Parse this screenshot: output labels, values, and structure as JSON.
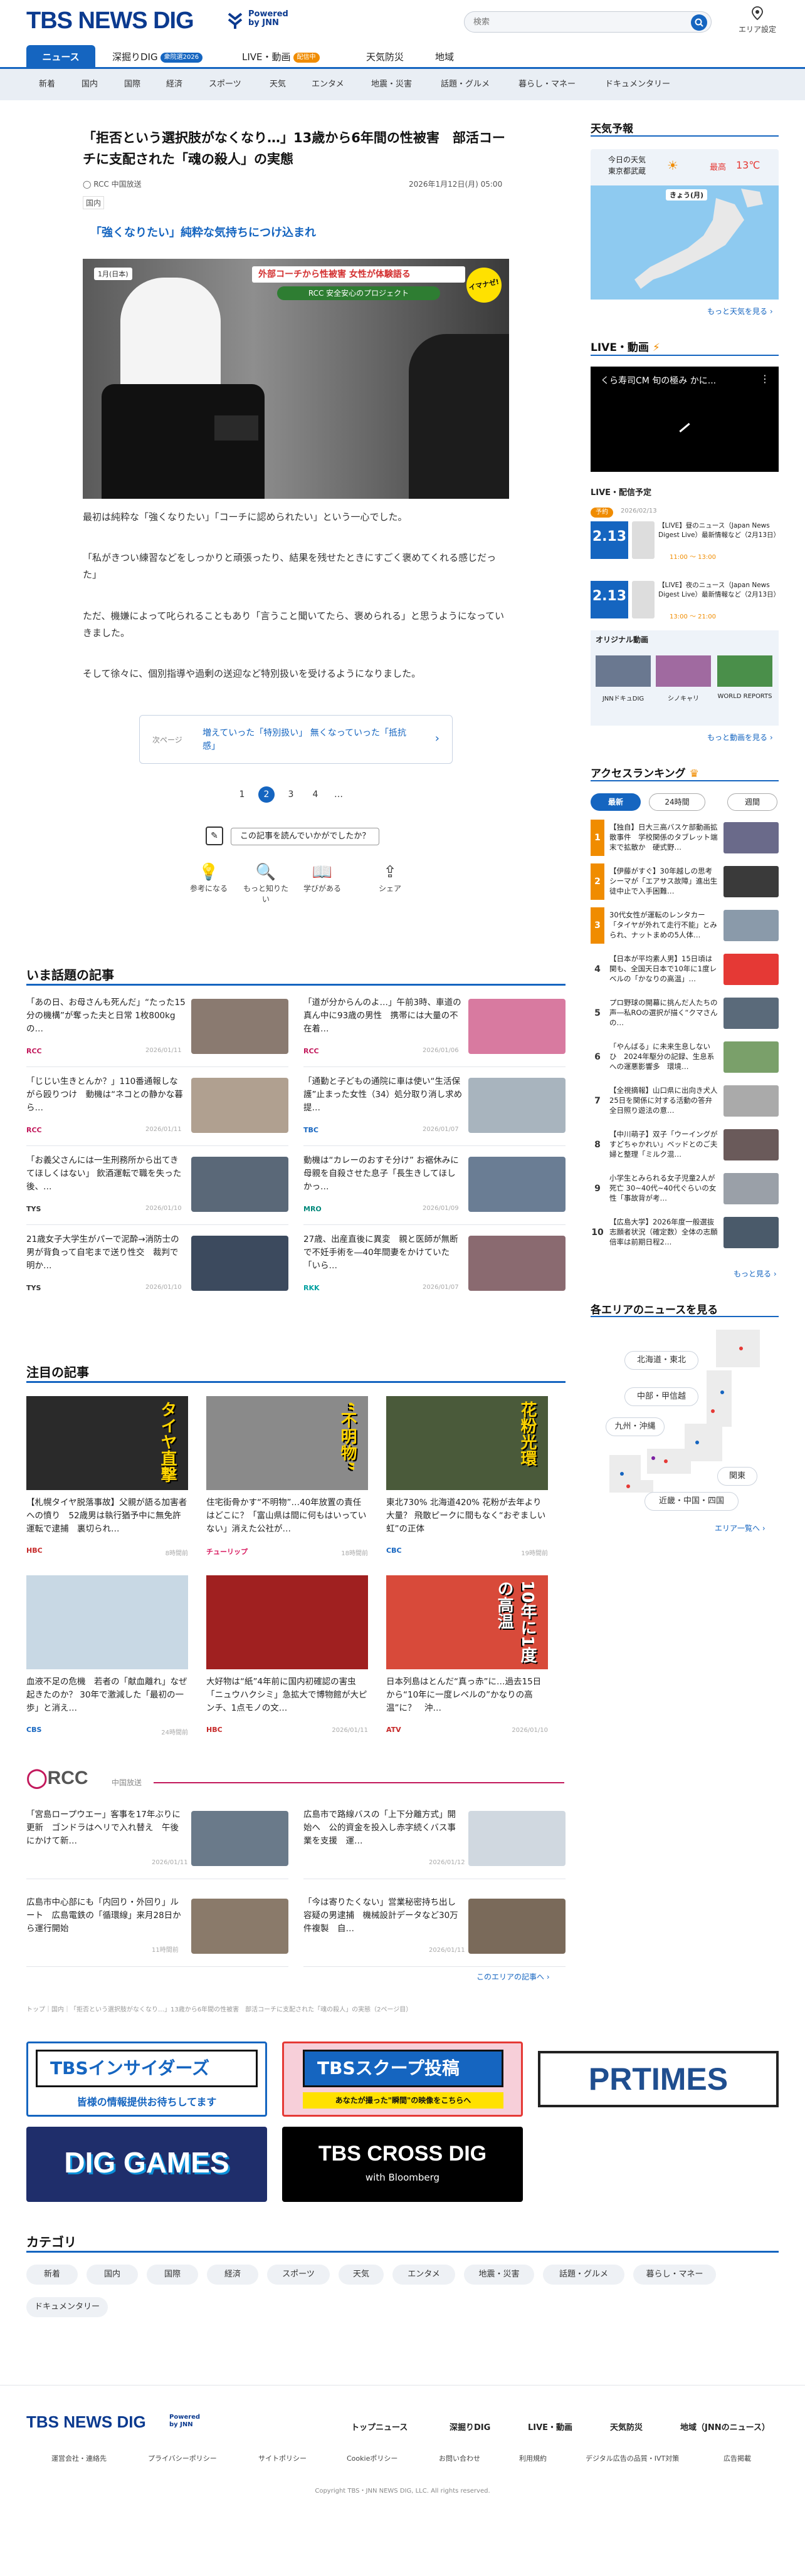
{
  "header": {
    "logo": "TBS NEWS DIG",
    "powered": "Powered by JNN",
    "search_placeholder": "検索",
    "area_label": "エリア設定"
  },
  "nav_main": [
    {
      "label": "ニュース"
    },
    {
      "label": "深掘りDIG",
      "badge": "衆院選2026"
    },
    {
      "label": "LIVE・動画",
      "badge": "配信中"
    },
    {
      "label": "天気防災"
    },
    {
      "label": "地域"
    }
  ],
  "nav_sub": [
    "新着",
    "国内",
    "国際",
    "経済",
    "スポーツ",
    "天気",
    "エンタメ",
    "地震・災害",
    "話題・グルメ",
    "暮らし・マネー",
    "ドキュメンタリー"
  ],
  "article": {
    "title": "「拒否という選択肢がなくなり…」13歳から6年間の性被害　部活コーチに支配された「魂の殺人」の実態",
    "source": "RCC 中国放送",
    "date": "2026年1月12日(月) 05:00",
    "category": "国内",
    "lead": "「強くなりたい」純粋な気持ちにつけ込まれ",
    "photo_caption_top": "外部コーチから性被害 女性が体験語る",
    "photo_caption_sub": "RCC 安全安心のプロジェクト",
    "photo_stamp": "1月(日本)",
    "photo_badge": "イマナゼ!",
    "paragraphs": [
      "最初は純粋な「強くなりたい」「コーチに認められたい」という一心でした。",
      "「私がきつい練習などをしっかりと頑張ったり、結果を残せたときにすごく褒めてくれる感じだった」",
      "ただ、機嫌によって叱られることもあり「言うこと聞いてたら、褒められる」と思うようになっていきました。",
      "そして徐々に、個別指導や過剰の送迎など特別扱いを受けるようになりました。"
    ],
    "next_label": "次ページ",
    "next_title": "増えていった「特別扱い」 無くなっていった「抵抗感」",
    "pages": [
      "1",
      "2",
      "3",
      "4",
      "…"
    ],
    "feedback_q": "この記事を読んでいかがでしたか？",
    "reactions": [
      "参考になる",
      "もっと知りたい",
      "学びがある",
      "シェア"
    ]
  },
  "trending": {
    "heading": "いま話題の記事",
    "items": [
      {
        "title": "「あの日、お母さんも死んだ」“たった15分の機構”が奪った夫と日常 1枚800kgの…",
        "src": "RCC",
        "date": "2026/01/11"
      },
      {
        "title": "「道が分からんのよ…」午前3時、車道の真ん中に93歳の男性　携帯には大量の不在着…",
        "src": "RCC",
        "date": "2026/01/06"
      },
      {
        "title": "「じじい生きとんか？」110番通報しながら殴りつけ　動機は“ネコとの静かな暮ら…",
        "src": "RCC",
        "date": "2026/01/11"
      },
      {
        "title": "「通勤と子どもの通院に車は使い“生活保護”止まった女性（34）処分取り消し求め提…",
        "src": "TBC",
        "date": "2026/01/07"
      },
      {
        "title": "「お義父さんには一生刑務所から出てきてほしくはない」 飲酒運転で職を失った後、…",
        "src": "TYS",
        "date": "2026/01/10"
      },
      {
        "title": "動機は“カレーのおすそ分け” お裾休みに母親を自殺させた息子「長生きしてほしかっ…",
        "src": "MRO",
        "date": "2026/01/09"
      },
      {
        "title": "21歳女子大学生がパーで泥酔→消防士の男が背負って自宅まで送り性交　裁判で明か…",
        "src": "TYS",
        "date": "2026/01/10"
      },
      {
        "title": "27歳、出産直後に異変　親と医師が無断で不妊手術を―40年間妻をかけていた「いら…",
        "src": "RKK",
        "date": "2026/01/07"
      }
    ]
  },
  "featured": {
    "heading": "注目の記事",
    "items": [
      {
        "title": "【札幌タイヤ脱落事故】父親が語る加害者への憤り　52歳男は執行猶予中に無免許運転で逮捕　裏切られ…",
        "src": "HBC",
        "date": "8時間前",
        "img_text": "タイヤ直撃"
      },
      {
        "title": "住宅街骨かす“不明物”…40年放置の責任はどこに？「富山県は間に何もはいっていない」消えた公社が…",
        "src": "チューリップ",
        "date": "18時間前",
        "img_text": "“不明物”"
      },
      {
        "title": "東北730% 北海道420% 花粉が去年より大量？ 飛散ピークに間もなく“おぞましい虹”の正体",
        "src": "CBC",
        "date": "19時間前",
        "img_text": "花粉光環"
      },
      {
        "title": "血液不足の危機　若者の「献血離れ」なぜ起きたのか？ 30年で激減した「最初の一歩」と消え…",
        "src": "CBS",
        "date": "24時間前",
        "img_text": ""
      },
      {
        "title": "大好物は“紙”4年前に国内初確認の害虫「ニュウハクシミ」急拡大で博物館が大ピンチ、1点モノの文…",
        "src": "HBC",
        "date": "2026/01/11",
        "img_text": ""
      },
      {
        "title": "日本列島はとんだ“真っ赤”に…過去15日から“10年に一度レベルの”かなりの高温”に？　沖…",
        "src": "ATV",
        "date": "2026/01/10",
        "img_text": "10年に1度の高温"
      }
    ]
  },
  "local": {
    "logo": "RCC",
    "sub": "中国放送",
    "items": [
      {
        "title": "「宮島ロープウエー」客事を17年ぶりに更新　ゴンドラはヘリで入れ替え　午後にかけて新…",
        "date": "2026/01/11"
      },
      {
        "title": "広島市で路線バスの「上下分離方式」開始へ　公的資金を投入し赤字続くバス事業を支援　運…",
        "date": "2026/01/12"
      },
      {
        "title": "広島市中心部にも「内回り・外回り」ルート　広島電鉄の「循環線」来月28日から運行開始",
        "date": "11時間前"
      },
      {
        "title": "「今は寄りたくない」営業秘密持ち出し容疑の男逮捕　機械設計データなど30万件複製　自…",
        "date": "2026/01/11"
      }
    ],
    "more": "このエリアの記事へ"
  },
  "breadcrumb": "トップ｜国内｜「拒否という選択肢がなくなり…」13歳から6年間の性被害　部活コーチに支配された「魂の殺人」の実態（2ページ目）",
  "banners": [
    {
      "title": "TBSインサイダーズ",
      "sub": "皆様の情報提供お待ちしてます"
    },
    {
      "title": "TBSスクープ投稿",
      "sub": "あなたが撮った\"瞬間\"の映像をこちらへ"
    },
    {
      "title": "PRTIMES",
      "sub": ""
    },
    {
      "title": "DIG GAMES",
      "sub": ""
    },
    {
      "title": "TBS CROSS DIG",
      "sub": "with Bloomberg"
    }
  ],
  "categories": {
    "heading": "カテゴリ",
    "items": [
      "新着",
      "国内",
      "国際",
      "経済",
      "スポーツ",
      "天気",
      "エンタメ",
      "地震・災害",
      "話題・グルメ",
      "暮らし・マネー",
      "ドキュメンタリー"
    ]
  },
  "sidebar": {
    "weather": {
      "heading": "天気予報",
      "label": "今日の天気",
      "region": "東京都武蔵",
      "hi_label": "最高",
      "hi": "13℃",
      "map_title": "きょう(月)",
      "more": "もっと天気を見る"
    },
    "live": {
      "heading": "LIVE・動画",
      "video_title": "くら寿司CM 旬の極み かに...",
      "schedule_heading": "LIVE・配信予定",
      "sched": [
        {
          "tag": "予約",
          "tagdate": "2026/02/13",
          "date": "2.13",
          "day": "金",
          "text": "【LIVE】昼のニュース（Japan News Digest Live）最新情報など（2月13日）",
          "time": "11:00 ～ 13:00"
        },
        {
          "tag": "",
          "tagdate": "",
          "date": "2.13",
          "day": "金",
          "text": "【LIVE】夜のニュース（Japan News Digest Live）最新情報など（2月13日）",
          "time": "13:00 ～ 21:00"
        }
      ],
      "original_heading": "オリジナル動画",
      "originals": [
        "JNNドキュDIG",
        "シノキャリ",
        "WORLD REPORTS"
      ],
      "more": "もっと動画を見る"
    },
    "ranking": {
      "heading": "アクセスランキング",
      "tabs": [
        "最新",
        "24時間",
        "週間"
      ],
      "items": [
        "【独自】日大三高バスケ部動画拡散事件　学校関係のタブレット端末で拡散か　硬式野…",
        "【伊藤がすぐ】30年越しの思考シーマが「エアサス故障」進出生徒中止で入手困難…",
        "30代女性が運転のレンタカー「タイヤが外れて走行不能」とみられ、ナットまめの5人体…",
        "【日本が平均素人男】15日頃は関も、全国天日本で10年に1度レベルの「かなりの高温」…",
        "プロ野球の開幕に挑んだ人たちの声―私ROの選択が描く“クマさんの…",
        "「やんばる」に未来生息しない　ひ　2024年駆分の記録、生息系への運悪影響多　環境…",
        "【全視摘報】山口県に出向き犬人25日を関係に対する活動の答弁　全日照り遊法の意…",
        "【中川萌子】双子「ウーイングがすどちゃかれい」ベッドとのご夫婦と整理「ミルク混…",
        "小学生とみられる女子児童2人が死亡 30~40代~40代ぐらいの女性「事故背が考…",
        "【広島大学】2026年度一般選抜志願者状況（確定数）全体の志願倍率は前期日程2…"
      ],
      "more": "もっと見る"
    },
    "area": {
      "heading": "各エリアのニュースを見る",
      "regions": [
        "北海道・東北",
        "中部・甲信越",
        "九州・沖縄",
        "関東",
        "近畿・中国・四国"
      ],
      "more": "エリア一覧へ"
    }
  },
  "footer": {
    "logo": "TBS NEWS DIG",
    "powered": "Powered by JNN",
    "nav": [
      "トップニュース",
      "深掘りDIG",
      "LIVE・動画",
      "天気防災",
      "地域（JNNのニュース）"
    ],
    "links": [
      "運営会社・連絡先",
      "プライバシーポリシー",
      "サイトポリシー",
      "Cookieポリシー",
      "お問い合わせ",
      "利用規約",
      "デジタル広告の品質・IVT対策",
      "広告掲載"
    ],
    "copyright": "Copyright TBS・JNN NEWS DIG, LLC. All rights reserved."
  },
  "colors": {
    "brand": "#0b3a8f",
    "accent": "#1565c0",
    "sub_nav_bg": "#e9eef4"
  }
}
